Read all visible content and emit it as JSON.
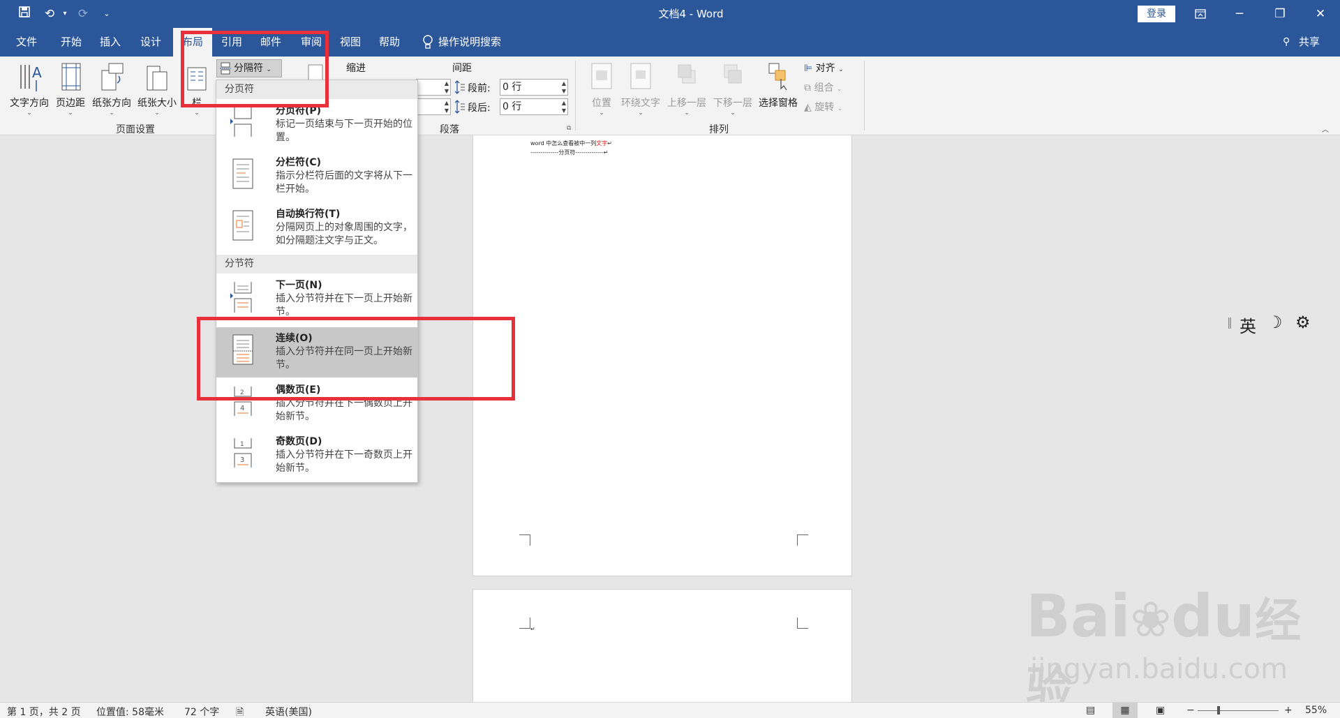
{
  "window": {
    "title": "文档4  -  Word",
    "login": "登录",
    "share": "共享"
  },
  "tabs": [
    "文件",
    "开始",
    "插入",
    "设计",
    "布局",
    "引用",
    "邮件",
    "审阅",
    "视图",
    "帮助"
  ],
  "tell_me": "操作说明搜索",
  "ribbon": {
    "page_setup": {
      "text_direction": "文字方向",
      "margins": "页边距",
      "orientation": "纸张方向",
      "size": "纸张大小",
      "columns": "栏",
      "breaks": "分隔符",
      "label": "页面设置"
    },
    "paragraph": {
      "indent": "缩进",
      "spacing": "间距",
      "before_label": "段前:",
      "before_value": "0 行",
      "after_label": "段后:",
      "after_value": "0 行",
      "label": "段落"
    },
    "arrange": {
      "position": "位置",
      "wrap_text": "环绕文字",
      "bring_forward": "上移一层",
      "send_backward": "下移一层",
      "selection_pane": "选择窗格",
      "align": "对齐",
      "group": "组合",
      "rotate": "旋转",
      "label": "排列"
    }
  },
  "menu": {
    "page_breaks_header": "分页符",
    "section_breaks_header": "分节符",
    "items": [
      {
        "title": "分页符(P)",
        "desc": "标记一页结束与下一页开始的位置。"
      },
      {
        "title": "分栏符(C)",
        "desc": "指示分栏符后面的文字将从下一栏开始。"
      },
      {
        "title": "自动换行符(T)",
        "desc": "分隔网页上的对象周围的文字，如分隔题注文字与正文。"
      },
      {
        "title": "下一页(N)",
        "desc": "插入分节符并在下一页上开始新节。"
      },
      {
        "title": "连续(O)",
        "desc": "插入分节符并在同一页上开始新节。"
      },
      {
        "title": "偶数页(E)",
        "desc": "插入分节符并在下一偶数页上开始新节。"
      },
      {
        "title": "奇数页(D)",
        "desc": "插入分节符并在下一奇数页上开始新节。"
      }
    ]
  },
  "document": {
    "line1_a": "word 中怎么查看被中一列",
    "line1_red": "文字",
    "line1_end": "↵",
    "line2": "--------------分页符--------------↵",
    "para_mark": "↵"
  },
  "ime": {
    "lang": "英"
  },
  "status": {
    "page": "第 1 页，共 2 页",
    "position": "位置值: 58毫米",
    "words": "72 个字",
    "language": "英语(美国)",
    "zoom": "55%"
  },
  "watermark": {
    "brand": "Bai",
    "brand2": "du",
    "brand_cn": "经验",
    "url": "jingyan.baidu.com"
  },
  "colors": {
    "accent": "#2b579a",
    "highlight": "#e8303a",
    "red_text": "#e0201a"
  }
}
